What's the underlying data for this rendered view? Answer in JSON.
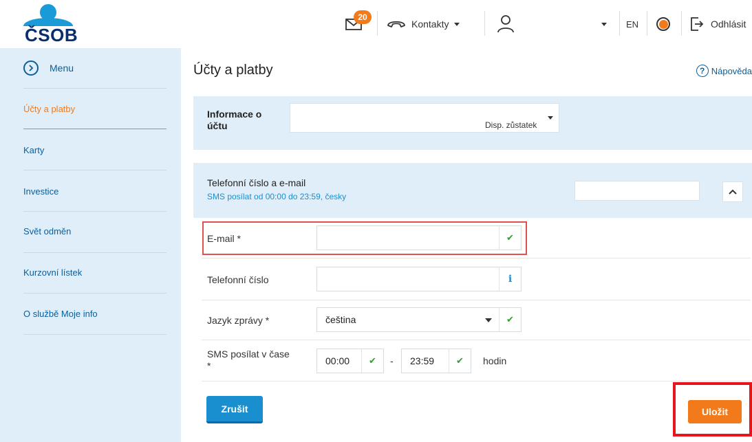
{
  "header": {
    "logo_text": "ČSOB",
    "mail_count": "20",
    "contacts_label": "Kontakty",
    "language": "EN",
    "logout_label": "Odhlásit"
  },
  "sidebar": {
    "menu_label": "Menu",
    "items": [
      {
        "label": "Účty a platby",
        "active": true
      },
      {
        "label": "Karty"
      },
      {
        "label": "Investice"
      },
      {
        "label": "Svět odměn"
      },
      {
        "label": "Kurzovní lístek"
      },
      {
        "label": "O službě Moje info"
      }
    ]
  },
  "main": {
    "title": "Účty a platby",
    "help_label": "Nápověda",
    "account_info": {
      "label": "Informace o účtu",
      "disp_label": "Disp. zůstatek"
    },
    "contact_panel": {
      "title": "Telefonní číslo a e-mail",
      "subtitle": "SMS posílat od 00:00 do 23:59, česky"
    },
    "form": {
      "email_label": "E-mail *",
      "email_value": "",
      "phone_label": "Telefonní číslo",
      "phone_value": "",
      "language_label": "Jazyk zprávy *",
      "language_value": "čeština",
      "sms_label": "SMS posílat v čase *",
      "sms_from": "00:00",
      "sms_dash": "-",
      "sms_to": "23:59",
      "sms_unit": "hodin"
    },
    "buttons": {
      "cancel": "Zrušit",
      "save": "Uložit"
    }
  },
  "colors": {
    "brand_blue": "#1a8fd0",
    "accent_orange": "#f27a1a",
    "panel_bg": "#dfeef8",
    "highlight_red": "#e8141a"
  }
}
